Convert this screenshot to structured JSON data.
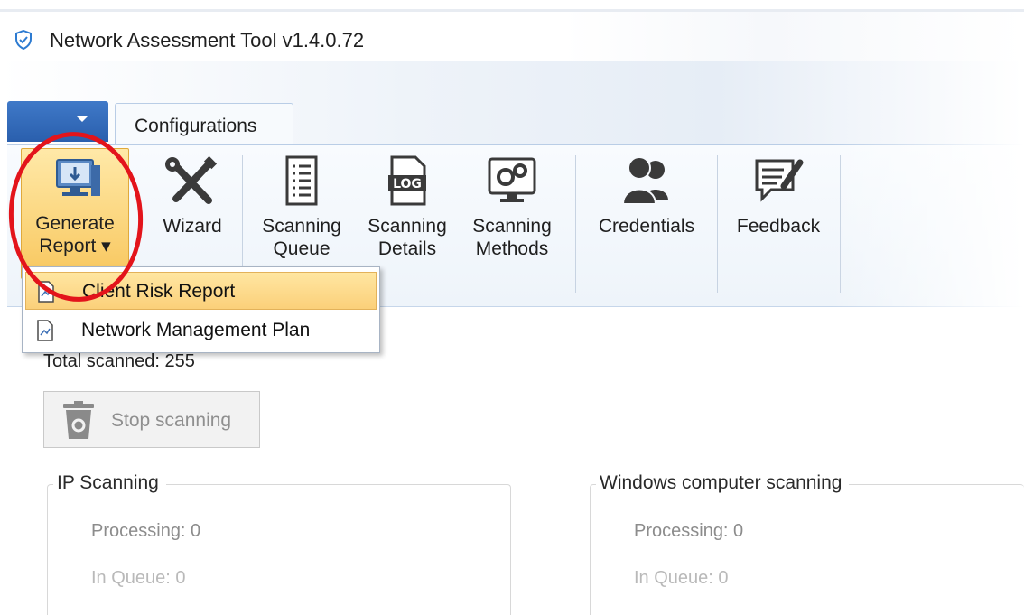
{
  "window": {
    "title": "Network Assessment Tool v1.4.0.72"
  },
  "tabs": [
    {
      "label": "Configurations"
    }
  ],
  "ribbon": {
    "buttons": [
      {
        "label_line1": "Generate",
        "label_line2": "Report ▾",
        "icon": "report-monitor-icon"
      },
      {
        "label_line1": "Wizard",
        "icon": "wrench-screwdriver-icon"
      },
      {
        "label_line1": "Scanning",
        "label_line2": "Queue",
        "icon": "list-document-icon"
      },
      {
        "label_line1": "Scanning",
        "label_line2": "Details",
        "icon": "log-document-icon"
      },
      {
        "label_line1": "Scanning",
        "label_line2": "Methods",
        "icon": "gears-monitor-icon"
      },
      {
        "label_line1": "Credentials",
        "icon": "users-icon"
      },
      {
        "label_line1": "Feedback",
        "icon": "feedback-pen-icon"
      }
    ]
  },
  "report_menu": {
    "items": [
      {
        "label": "Client Risk Report",
        "icon": "report-document-icon",
        "highlighted": true
      },
      {
        "label": "Network Management Plan",
        "icon": "report-document-icon",
        "highlighted": false
      }
    ]
  },
  "status": {
    "total_scanned": "Total scanned: 255"
  },
  "stop_button": {
    "label": "Stop scanning",
    "icon": "trash-bin-icon",
    "enabled": false
  },
  "groups": {
    "ip": {
      "title": "IP Scanning",
      "processing": "Processing: 0",
      "in_queue": "In Queue: 0"
    },
    "windows": {
      "title": "Windows computer scanning",
      "processing": "Processing: 0",
      "in_queue": "In Queue: 0"
    }
  },
  "colors": {
    "accent_blue": "#2a5fad",
    "highlight_gold": "#f8c75e",
    "annotation_red": "#e3141b"
  }
}
